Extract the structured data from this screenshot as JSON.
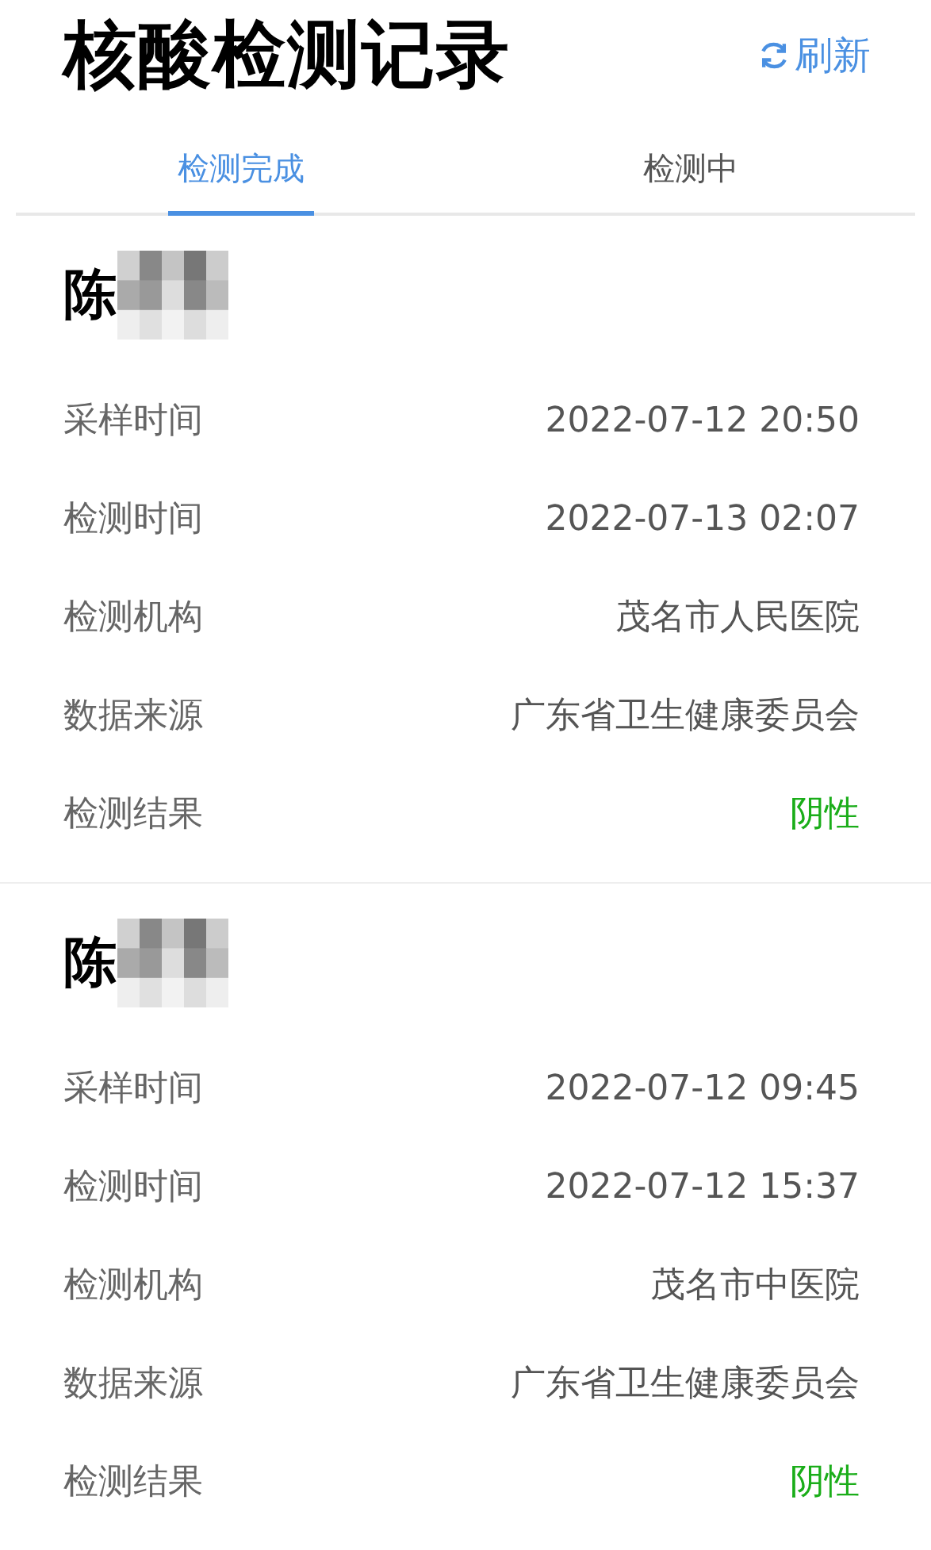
{
  "header": {
    "title": "核酸检测记录",
    "refresh_label": "刷新"
  },
  "tabs": [
    {
      "label": "检测完成",
      "selected": true
    },
    {
      "label": "检测中",
      "selected": false
    }
  ],
  "records": [
    {
      "name": "陈",
      "rows": [
        {
          "label": "采样时间",
          "value": "2022-07-12 20:50",
          "kind": "plain"
        },
        {
          "label": "检测时间",
          "value": "2022-07-13 02:07",
          "kind": "plain"
        },
        {
          "label": "检测机构",
          "value": "茂名市人民医院",
          "kind": "plain"
        },
        {
          "label": "数据来源",
          "value": "广东省卫生健康委员会",
          "kind": "plain"
        },
        {
          "label": "检测结果",
          "value": "阴性",
          "kind": "negative"
        }
      ]
    },
    {
      "name": "陈",
      "rows": [
        {
          "label": "采样时间",
          "value": "2022-07-12 09:45",
          "kind": "plain"
        },
        {
          "label": "检测时间",
          "value": "2022-07-12 15:37",
          "kind": "plain"
        },
        {
          "label": "检测机构",
          "value": "茂名市中医院",
          "kind": "plain"
        },
        {
          "label": "数据来源",
          "value": "广东省卫生健康委员会",
          "kind": "plain"
        },
        {
          "label": "检测结果",
          "value": "阴性",
          "kind": "negative"
        }
      ]
    }
  ]
}
